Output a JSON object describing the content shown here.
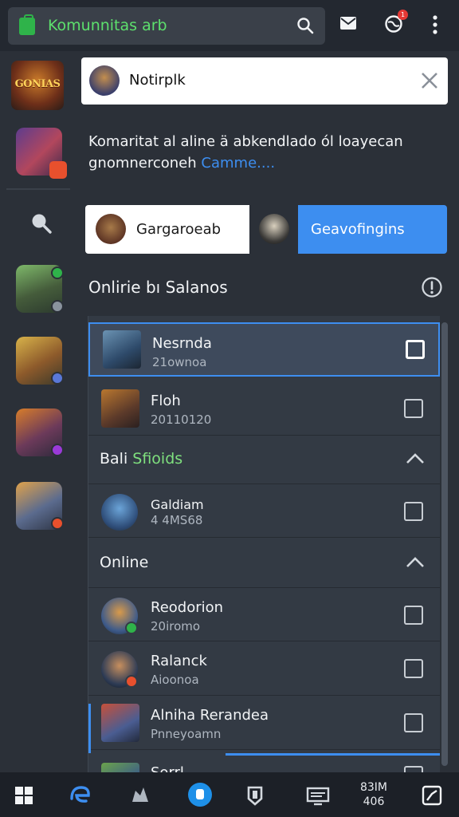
{
  "topbar": {
    "title": "Komunnitas arb",
    "notification_count": "1"
  },
  "rail": {
    "logo_text": "GONIAS",
    "apps": [
      {
        "name": "app-1",
        "accent": "#e8502d"
      },
      {
        "name": "app-2",
        "accent": "#2fb34a"
      },
      {
        "name": "app-3",
        "accent": "#5a78d8"
      },
      {
        "name": "app-4",
        "accent": "#9b3ad8"
      },
      {
        "name": "app-5",
        "accent": "#e8502d"
      }
    ]
  },
  "notification": {
    "text": "Notirplk"
  },
  "description": {
    "text": "Komaritat al aline ä abkendlado ól loayecan gnomnerconeh",
    "link": "Camme...."
  },
  "tabs": {
    "first_label": "Gargaroeab",
    "second_label": "Geavofingins"
  },
  "section": {
    "title": "Onlirie bı Salanos"
  },
  "list": {
    "rows_top": [
      {
        "name": "Nesrnda",
        "sub": "21ownoa"
      },
      {
        "name": "Floh",
        "sub": "20110120"
      }
    ],
    "group1": {
      "prefix": "Bali ",
      "highlight": "Sfioids"
    },
    "rows_mid": [
      {
        "name": "Galdiam",
        "sub": "4 4MS68"
      }
    ],
    "group2": {
      "title": "Online"
    },
    "rows_bottom": [
      {
        "name": "Reodorion",
        "sub": "20iromo"
      },
      {
        "name": "Ralanck",
        "sub": "Aioonoa"
      },
      {
        "name": "Alniha Rerandea",
        "sub": "Pnneyoamn"
      },
      {
        "name": "Sorrl",
        "sub": ""
      }
    ]
  },
  "taskbar": {
    "time_line1": "83IM",
    "time_line2": "406"
  },
  "colors": {
    "accent": "#3d8ef0",
    "online": "#7fe07e",
    "background": "#2b3038"
  }
}
